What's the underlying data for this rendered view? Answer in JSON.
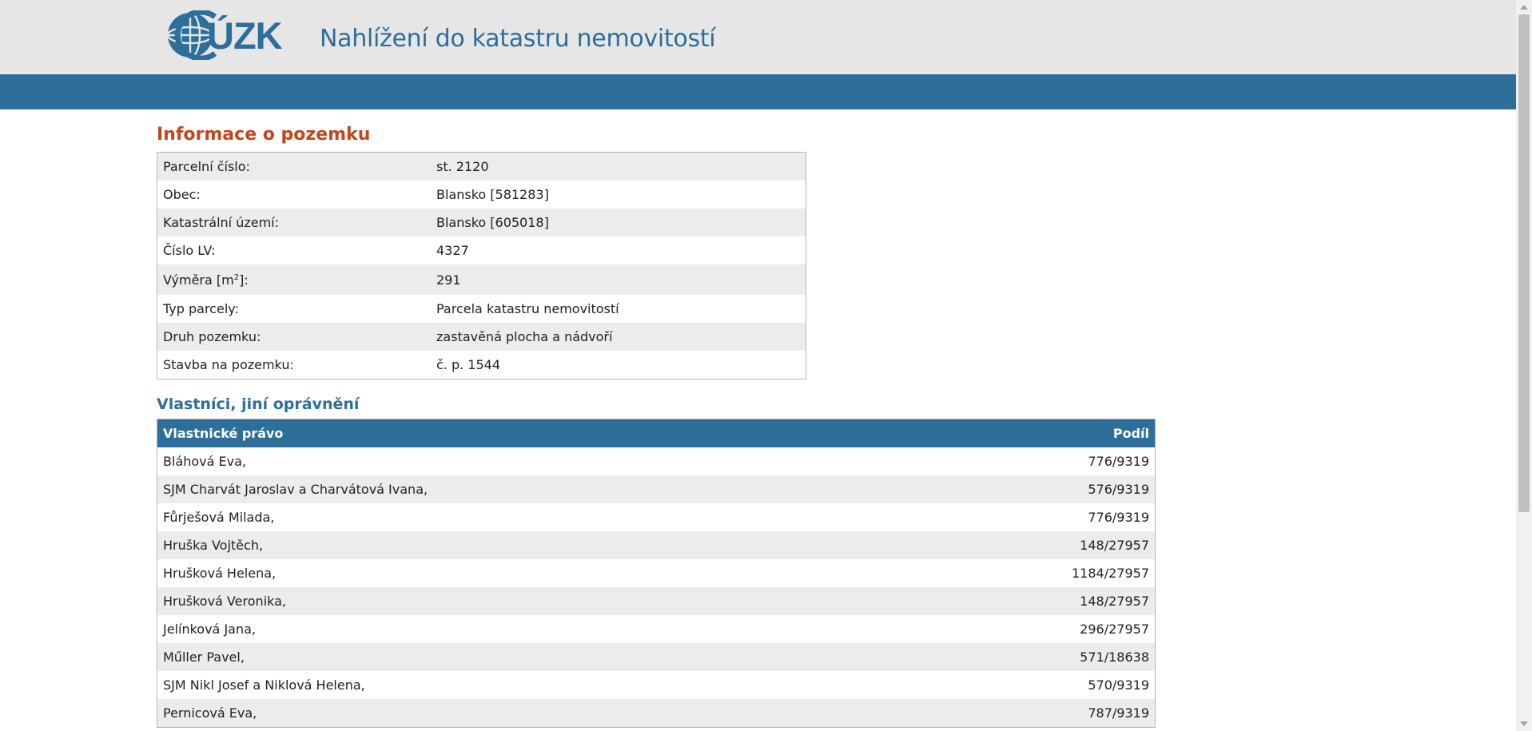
{
  "header": {
    "logo_text": "ÚZK",
    "site_title": "Nahlížení do katastru nemovitostí"
  },
  "parcel": {
    "title": "Informace o pozemku",
    "rows": {
      "parcel_number": {
        "label": "Parcelní číslo:",
        "value": "st. 2120"
      },
      "municipality": {
        "label": "Obec:",
        "value": "Blansko [581283]"
      },
      "cadastral_area": {
        "label": "Katastrální území:",
        "value": "Blansko [605018]"
      },
      "lv_number": {
        "label": "Číslo LV:",
        "value": "4327"
      },
      "area": {
        "label_before": "Výměra [m",
        "label_sup": "2",
        "label_after": "]:",
        "value": "291"
      },
      "parcel_type": {
        "label": "Typ parcely:",
        "value": "Parcela katastru nemovitostí"
      },
      "land_kind": {
        "label": "Druh pozemku:",
        "value": "zastavěná plocha a nádvoří"
      },
      "building": {
        "label": "Stavba na pozemku:",
        "value": "č. p. 1544"
      }
    }
  },
  "owners": {
    "title": "Vlastníci, jiní oprávnění",
    "columns": {
      "name": "Vlastnické právo",
      "share": "Podíl"
    },
    "rows": [
      {
        "name": "Bláhová Eva,",
        "share": "776/9319"
      },
      {
        "name": "SJM Charvát Jaroslav a Charvátová Ivana,",
        "share": "576/9319"
      },
      {
        "name": "Fůrješová Milada,",
        "share": "776/9319"
      },
      {
        "name": "Hruška Vojtěch,",
        "share": "148/27957"
      },
      {
        "name": "Hrušková Helena,",
        "share": "1184/27957"
      },
      {
        "name": "Hrušková Veronika,",
        "share": "148/27957"
      },
      {
        "name": "Jelínková Jana,",
        "share": "296/27957"
      },
      {
        "name": "Műller Pavel,",
        "share": "571/18638"
      },
      {
        "name": "SJM Nikl Josef a Niklová Helena,",
        "share": "570/9319"
      },
      {
        "name": "Pernicová Eva,",
        "share": "787/9319"
      }
    ]
  },
  "icons": {
    "logo": "globe-logo-icon",
    "scroll_up": "scroll-up-arrow-icon",
    "scroll_down": "scroll-down-arrow-icon"
  },
  "colors": {
    "brand_blue": "#2e6e9b",
    "title_orange": "#c0471d",
    "header_bg": "#e6e6e6",
    "row_alt": "#ececec"
  }
}
